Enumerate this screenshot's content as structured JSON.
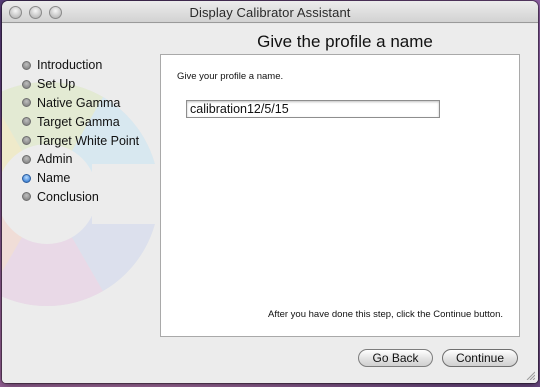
{
  "window": {
    "title": "Display Calibrator Assistant"
  },
  "page": {
    "heading": "Give the profile a name"
  },
  "steps": [
    {
      "label": "Introduction",
      "state": "done"
    },
    {
      "label": "Set Up",
      "state": "todo"
    },
    {
      "label": "Native Gamma",
      "state": "done"
    },
    {
      "label": "Target Gamma",
      "state": "done"
    },
    {
      "label": "Target White Point",
      "state": "done"
    },
    {
      "label": "Admin",
      "state": "todo"
    },
    {
      "label": "Name",
      "state": "active"
    },
    {
      "label": "Conclusion",
      "state": "todo"
    }
  ],
  "panel": {
    "prompt": "Give your profile a name.",
    "profile_name_value": "calibration12/5/15",
    "hint": "After you have done this step, click the Continue button."
  },
  "buttons": {
    "go_back": "Go Back",
    "continue": "Continue"
  },
  "colors": {
    "active_step": "#4f8fdc",
    "window_bg": "#ececec"
  }
}
